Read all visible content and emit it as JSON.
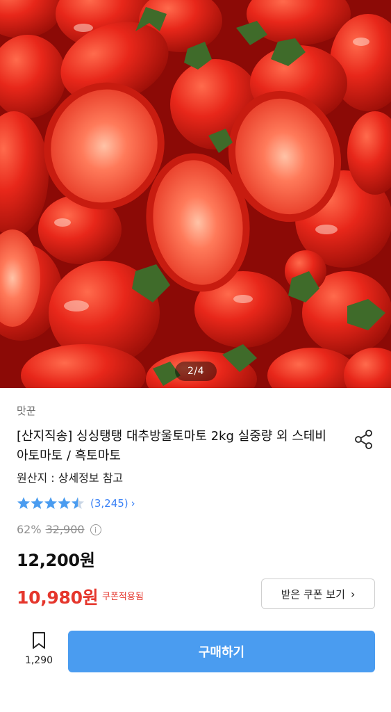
{
  "gallery": {
    "indicator": "2/4",
    "image_alt": "tomatoes-photo"
  },
  "product": {
    "brand": "맛꾼",
    "title": "[산지직송] 싱싱탱탱 대추방울토마토 2kg 실중량 외 스테비아토마토 / 흑토마토",
    "origin": "원산지 : 상세정보 참고",
    "rating": {
      "stars": 4.5,
      "count": "(3,245)"
    },
    "discount_rate": "62%",
    "original_price": "32,900",
    "price": "12,200원",
    "coupon_price": "10,980원",
    "coupon_tag": "쿠폰적용됨"
  },
  "actions": {
    "coupon_button": "받은 쿠폰 보기",
    "wishlist_count": "1,290",
    "buy_button": "구매하기"
  },
  "colors": {
    "accent_blue": "#4a9cf0",
    "sale_red": "#e5362c",
    "star_blue": "#3b82f6"
  }
}
